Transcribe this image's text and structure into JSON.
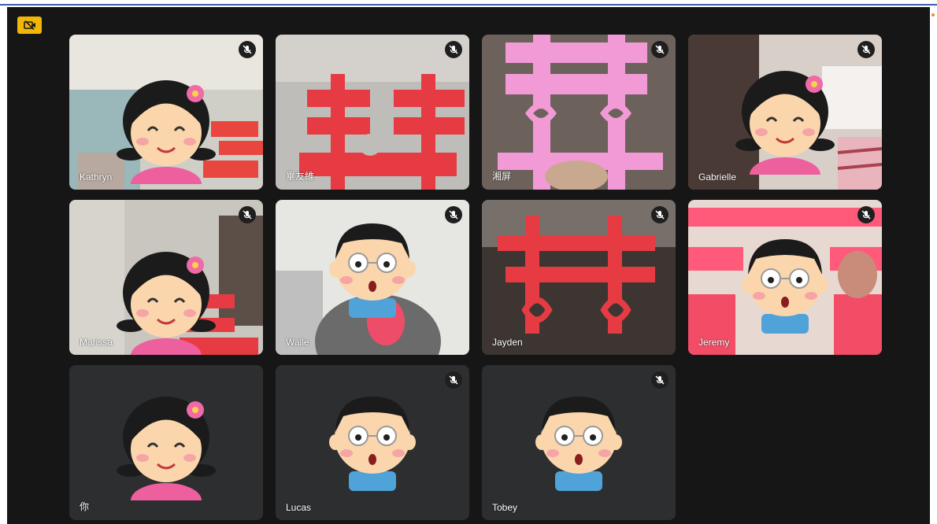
{
  "meeting": {
    "participants": [
      {
        "name": "Kathryn",
        "muted": true,
        "avatar": "girl-avatar",
        "bg": "pink-red-paper-cut",
        "camera": "on"
      },
      {
        "name": "畢友維",
        "muted": true,
        "avatar": "none",
        "bg": "red-paper-cut",
        "camera": "on"
      },
      {
        "name": "湘屏",
        "muted": true,
        "avatar": "none",
        "bg": "lilac-paper-cut",
        "camera": "on"
      },
      {
        "name": "Gabrielle",
        "muted": true,
        "avatar": "girl-avatar",
        "bg": "pink-room",
        "camera": "on"
      },
      {
        "name": "Marissa",
        "muted": true,
        "avatar": "girl-avatar",
        "bg": "room-red-paper-cut",
        "camera": "on"
      },
      {
        "name": "Walle",
        "muted": true,
        "avatar": "boy-avatar",
        "bg": "white-room",
        "camera": "on"
      },
      {
        "name": "Jayden",
        "muted": true,
        "avatar": "none",
        "bg": "red-paper-cut-face",
        "camera": "on"
      },
      {
        "name": "Jeremy",
        "muted": true,
        "avatar": "boy-avatar",
        "bg": "pink-red-paper-cut",
        "camera": "on"
      },
      {
        "name": "你",
        "muted": false,
        "avatar": "girl-avatar",
        "bg": "none",
        "camera": "off"
      },
      {
        "name": "Lucas",
        "muted": true,
        "avatar": "boy-avatar",
        "bg": "none",
        "camera": "off"
      },
      {
        "name": "Tobey",
        "muted": true,
        "avatar": "boy-avatar",
        "bg": "none",
        "camera": "off"
      }
    ]
  },
  "colors": {
    "stage_bg": "#161616",
    "tile_dark": "#2d2e30",
    "badge": "#f2b705",
    "paper_red": "#e63b43",
    "paper_pink": "#f29ad6",
    "top_line": "#3d5bb0"
  },
  "icons": {
    "badge": "camera-off-icon",
    "mute": "mic-off-icon"
  }
}
